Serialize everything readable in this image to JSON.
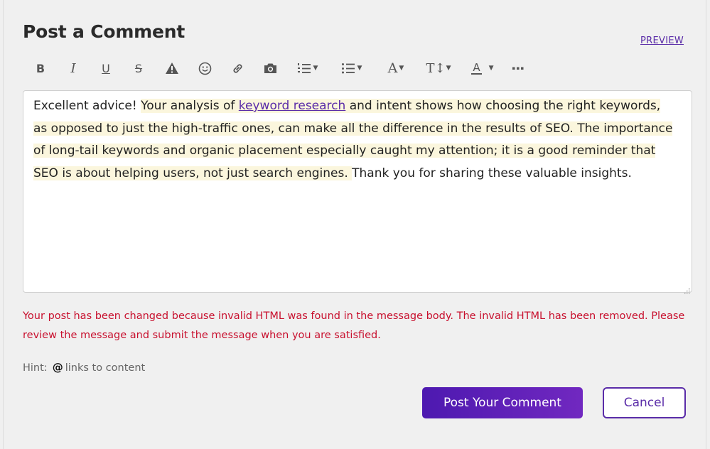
{
  "header": {
    "title": "Post a Comment",
    "preview_label": "PREVIEW"
  },
  "toolbar": {
    "bold": "B",
    "italic": "I",
    "underline": "U",
    "strikethrough": "S",
    "font_color": "A",
    "font_family": "A",
    "font_size": "T↕",
    "icons": [
      "bold-icon",
      "italic-icon",
      "underline-icon",
      "strikethrough-icon",
      "warning-icon",
      "emoji-icon",
      "link-icon",
      "camera-icon",
      "numbered-list-icon",
      "bulleted-list-icon",
      "font-family-icon",
      "font-size-icon",
      "font-color-icon",
      "more-icon"
    ]
  },
  "editor": {
    "segments": {
      "s1": "Excellent advice! ",
      "s2": "Your analysis of ",
      "s3_link": "keyword research",
      "s4": " and intent shows how choosing the right keywords, as opposed to just the high-traffic ones, can make all the difference in the results of SEO. ",
      "s5": " The importance of long-tail keywords and organic placement especially caught my attention; it is a good reminder that SEO is about helping users, not just search engines. ",
      "s6": " Thank you for sharing these valuable insights."
    }
  },
  "error_message": "Your post has been changed because invalid HTML was found in the message body. The invalid HTML has been removed. Please review the message and submit the message when you are satisfied.",
  "hint": {
    "label": "Hint:",
    "at": "@",
    "text": "links to content"
  },
  "actions": {
    "post_label": "Post Your Comment",
    "cancel_label": "Cancel"
  },
  "colors": {
    "accent": "#5a2ca8",
    "error": "#c8102e",
    "highlight": "#fbf6dd"
  }
}
